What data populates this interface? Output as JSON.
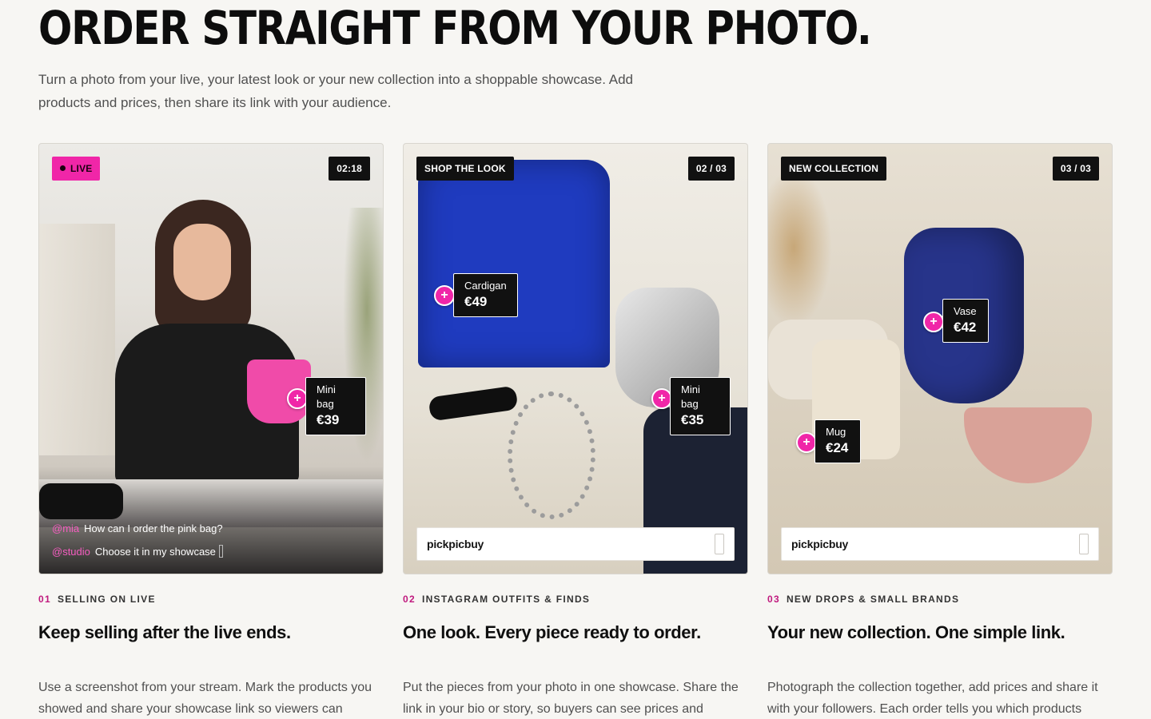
{
  "hero": {
    "title": "ORDER STRAIGHT FROM YOUR PHOTO.",
    "subtitle": "Turn a photo from your live, your latest look or your new collection into a shoppable showcase. Add products and prices, then share its link with your audience."
  },
  "colors": {
    "accent": "#f026a8",
    "label_bg": "#111111",
    "kicker_num": "#c0197e"
  },
  "cards": [
    {
      "badge": "LIVE",
      "counter": "02:18",
      "hotspots": [
        {
          "name": "Mini bag",
          "price": "€39"
        }
      ],
      "chat": [
        {
          "handle": "@mia",
          "text": "How can I order the pink bag?"
        },
        {
          "handle": "@studio",
          "text": "Choose it in my showcase"
        }
      ],
      "kicker_num": "01",
      "kicker": "SELLING ON LIVE",
      "heading": "Keep selling after the live ends.",
      "body": "Use a screenshot from your stream. Mark the products you showed and share your showcase link so viewers can"
    },
    {
      "badge": "SHOP THE LOOK",
      "counter": "02 / 03",
      "hotspots": [
        {
          "name": "Cardigan",
          "price": "€49"
        },
        {
          "name": "Mini bag",
          "price": "€35"
        }
      ],
      "share_brand": "pickpicbuy",
      "kicker_num": "02",
      "kicker": "INSTAGRAM OUTFITS & FINDS",
      "heading": "One look. Every piece ready to order.",
      "body": "Put the pieces from your photo in one showcase. Share the link in your bio or story, so buyers can see prices and"
    },
    {
      "badge": "NEW COLLECTION",
      "counter": "03 / 03",
      "hotspots": [
        {
          "name": "Vase",
          "price": "€42"
        },
        {
          "name": "Mug",
          "price": "€24"
        }
      ],
      "share_brand": "pickpicbuy",
      "kicker_num": "03",
      "kicker": "NEW DROPS & SMALL BRANDS",
      "heading": "Your new collection. One simple link.",
      "body": "Photograph the collection together, add prices and share it with your followers. Each order tells you which products"
    }
  ]
}
